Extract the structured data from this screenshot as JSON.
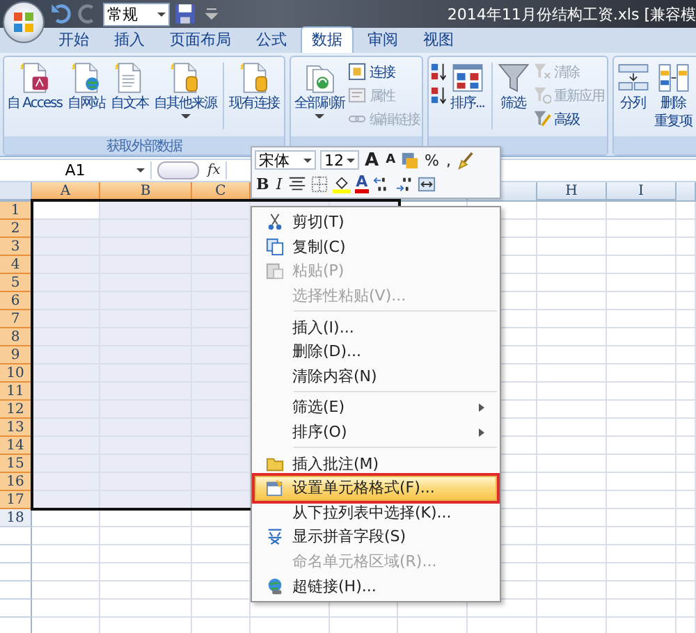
{
  "title_bar": {
    "number_format": "常规",
    "title": "2014年11月份结构工资.xls  [兼容模"
  },
  "tabs": [
    {
      "label": "开始",
      "selected": false
    },
    {
      "label": "插入",
      "selected": false
    },
    {
      "label": "页面布局",
      "selected": false
    },
    {
      "label": "公式",
      "selected": false
    },
    {
      "label": "数据",
      "selected": true
    },
    {
      "label": "审阅",
      "selected": false
    },
    {
      "label": "视图",
      "selected": false
    }
  ],
  "ribbon": {
    "groups": [
      {
        "label": "获取外部数据",
        "items": [
          {
            "kind": "large",
            "label": "自 Access"
          },
          {
            "kind": "large",
            "label": "自网站"
          },
          {
            "kind": "large",
            "label": "自文本"
          },
          {
            "kind": "large",
            "label": "自其他来源",
            "dropdown": true
          },
          {
            "kind": "separator"
          },
          {
            "kind": "large",
            "label": "现有连接"
          }
        ]
      },
      {
        "items": [
          {
            "kind": "large",
            "label": "全部刷新",
            "dropdown": true
          },
          {
            "kind": "stack",
            "buttons": [
              {
                "label": "连接",
                "disabled": false
              },
              {
                "label": "属性",
                "disabled": true
              },
              {
                "label": "编辑链接",
                "disabled": true
              }
            ]
          }
        ]
      },
      {
        "items": [
          {
            "kind": "sort-pair"
          },
          {
            "kind": "large",
            "label": "排序..."
          },
          {
            "kind": "separator"
          },
          {
            "kind": "large",
            "label": "筛选"
          },
          {
            "kind": "stack",
            "buttons": [
              {
                "label": "清除",
                "disabled": true
              },
              {
                "label": "重新应用",
                "disabled": true
              },
              {
                "label": "高级",
                "disabled": false
              }
            ]
          }
        ]
      },
      {
        "items": [
          {
            "kind": "large",
            "label": "分列"
          },
          {
            "kind": "large",
            "label": "删除",
            "label_2": "重复项"
          }
        ]
      }
    ]
  },
  "formula_bar": {
    "name_box": "A1",
    "fx": "fx"
  },
  "columns": [
    {
      "label": "A",
      "selected": true
    },
    {
      "label": "B",
      "selected": true
    },
    {
      "label": "C",
      "selected": true
    },
    {
      "label": "H",
      "selected": false
    },
    {
      "label": "I",
      "selected": false
    }
  ],
  "rows": [
    {
      "label": "1",
      "selected": true
    },
    {
      "label": "2",
      "selected": true
    },
    {
      "label": "3",
      "selected": true
    },
    {
      "label": "4",
      "selected": true
    },
    {
      "label": "5",
      "selected": true
    },
    {
      "label": "6",
      "selected": true
    },
    {
      "label": "7",
      "selected": true
    },
    {
      "label": "8",
      "selected": true
    },
    {
      "label": "9",
      "selected": true
    },
    {
      "label": "10",
      "selected": true
    },
    {
      "label": "11",
      "selected": true
    },
    {
      "label": "12",
      "selected": true
    },
    {
      "label": "13",
      "selected": true
    },
    {
      "label": "14",
      "selected": true
    },
    {
      "label": "15",
      "selected": true
    },
    {
      "label": "16",
      "selected": true
    },
    {
      "label": "17",
      "selected": true
    },
    {
      "label": "18",
      "selected": false
    }
  ],
  "mini_toolbar": {
    "font": "宋体",
    "size": "12",
    "row_1": [
      {
        "kind": "grow",
        "text": "A"
      },
      {
        "kind": "shrink",
        "text": "A"
      },
      {
        "kind": "icon"
      },
      {
        "kind": "text",
        "text": "%"
      },
      {
        "kind": "text",
        "text": ","
      },
      {
        "kind": "icon"
      }
    ],
    "row_2": [
      {
        "kind": "bold",
        "text": "B"
      },
      {
        "kind": "italic",
        "text": "I"
      },
      {
        "kind": "icon"
      },
      {
        "kind": "icon"
      },
      {
        "kind": "icon"
      },
      {
        "kind": "color",
        "text": "A"
      },
      {
        "kind": "icon"
      },
      {
        "kind": "icon"
      },
      {
        "kind": "icon"
      }
    ]
  },
  "context_menu": {
    "items": [
      {
        "kind": "item",
        "label": "剪切(T)",
        "disabled": false
      },
      {
        "kind": "item",
        "label": "复制(C)",
        "disabled": false
      },
      {
        "kind": "item",
        "label": "粘贴(P)",
        "disabled": true
      },
      {
        "kind": "item",
        "label": "选择性粘贴(V)...",
        "disabled": true
      },
      {
        "kind": "separator"
      },
      {
        "kind": "item",
        "label": "插入(I)...",
        "disabled": false
      },
      {
        "kind": "item",
        "label": "删除(D)...",
        "disabled": false
      },
      {
        "kind": "item",
        "label": "清除内容(N)",
        "disabled": false
      },
      {
        "kind": "separator"
      },
      {
        "kind": "submenu",
        "label": "筛选(E)",
        "disabled": false
      },
      {
        "kind": "submenu",
        "label": "排序(O)",
        "disabled": false
      },
      {
        "kind": "separator"
      },
      {
        "kind": "item",
        "label": "插入批注(M)",
        "disabled": false
      },
      {
        "kind": "item",
        "label": "设置单元格格式(F)...",
        "disabled": false,
        "selected": true,
        "outlined": true
      },
      {
        "kind": "item",
        "label": "从下拉列表中选择(K)...",
        "disabled": false
      },
      {
        "kind": "item",
        "label": "显示拼音字段(S)",
        "disabled": false
      },
      {
        "kind": "item",
        "label": "命名单元格区域(R)...",
        "disabled": true
      },
      {
        "kind": "item",
        "label": "超链接(H)...",
        "disabled": false
      }
    ]
  }
}
